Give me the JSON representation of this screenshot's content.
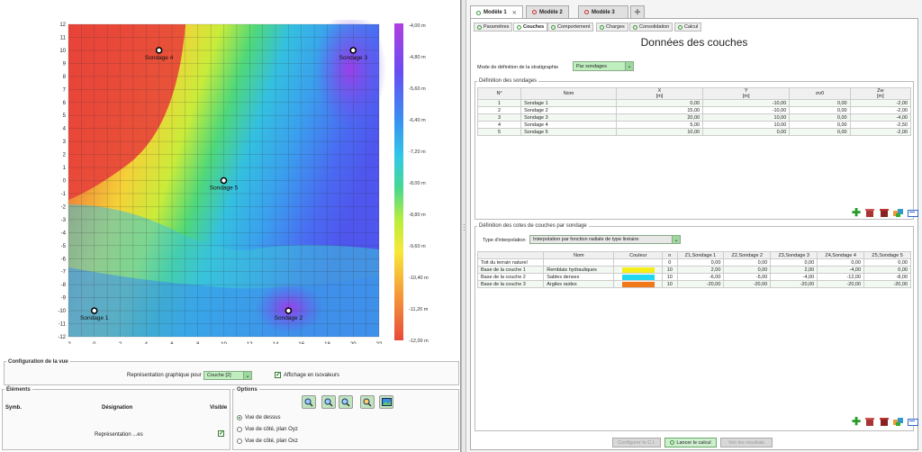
{
  "map": {
    "x_ticks": [
      "-2",
      "0",
      "2",
      "4",
      "6",
      "8",
      "10",
      "12",
      "14",
      "16",
      "18",
      "20",
      "22"
    ],
    "y_ticks": [
      "12",
      "11",
      "10",
      "9",
      "8",
      "7",
      "6",
      "5",
      "4",
      "3",
      "2",
      "1",
      "0",
      "-1",
      "-2",
      "-3",
      "-4",
      "-5",
      "-6",
      "-7",
      "-8",
      "-9",
      "-10",
      "-11",
      "-12"
    ],
    "points": [
      {
        "label": "Sondage 4",
        "x": 5,
        "y": 10
      },
      {
        "label": "Sondage 3",
        "x": 20,
        "y": 10
      },
      {
        "label": "Sondage 5",
        "x": 10,
        "y": 0
      },
      {
        "label": "Sondage 1",
        "x": 0,
        "y": -10
      },
      {
        "label": "Sondage 2",
        "x": 15,
        "y": -10
      }
    ],
    "colorbar_labels": [
      "-4,00 m",
      "-4,80 m",
      "-5,60 m",
      "-6,40 m",
      "-7,20 m",
      "-8,00 m",
      "-8,80 m",
      "-9,60 m",
      "-10,40 m",
      "-11,20 m",
      "-12,00 m"
    ]
  },
  "config": {
    "legend": "Configuration de la vue",
    "repr_label": "Représentation graphique pour",
    "repr_value": "Couche [2]",
    "isovaleurs_label": "Affichage en isovaleurs"
  },
  "elements": {
    "legend": "Éléments",
    "col_symb": "Symb.",
    "col_designation": "Désignation",
    "col_visible": "Visible",
    "row_label": "Représentation ...es"
  },
  "options": {
    "legend": "Options",
    "radio1": "Vue de dessus",
    "radio2": "Vue de côté, plan Oyz",
    "radio3": "Vue de côté, plan Oxz"
  },
  "tabs": [
    "Modèle 1",
    "Modèle 2",
    "Modèle 3"
  ],
  "subtabs": [
    "Paramètres",
    "Couches",
    "Comportement",
    "Charges",
    "Consolidation",
    "Calcul"
  ],
  "page_title": "Données des couches",
  "strat": {
    "label": "Mode de définition de la stratigraphie",
    "value": "Par sondages"
  },
  "sondages": {
    "legend": "Définition des sondages",
    "headers": [
      "N°",
      "Nom",
      "X\n[m]",
      "Y\n[m]",
      "σv0",
      "Zw\n[m]"
    ],
    "rows": [
      [
        "1",
        "Sondage 1",
        "0,00",
        "-10,00",
        "0,00",
        "-2,00"
      ],
      [
        "2",
        "Sondage 2",
        "15,00",
        "-10,00",
        "0,00",
        "-2,00"
      ],
      [
        "3",
        "Sondage 3",
        "20,00",
        "10,00",
        "0,00",
        "-4,00"
      ],
      [
        "4",
        "Sondage 4",
        "5,00",
        "10,00",
        "0,00",
        "-2,50"
      ],
      [
        "5",
        "Sondage 5",
        "10,00",
        "0,00",
        "0,00",
        "-2,00"
      ]
    ]
  },
  "cotes": {
    "legend": "Définition des cotes de couches par sondage",
    "interp_label": "Type d'interpolation",
    "interp_value": "Interpolation par fonction radiale de type linéaire",
    "headers": [
      "",
      "Nom",
      "Couleur",
      "n",
      "Z1,Sondage 1",
      "Z2,Sondage 2",
      "Z3,Sondage 3",
      "Z4,Sondage 4",
      "Z5,Sondage 5"
    ],
    "rows": [
      {
        "label": "Toit du terrain naturel",
        "nom": "",
        "color": "",
        "n": "0",
        "v": [
          "0,00",
          "0,00",
          "0,00",
          "0,00",
          "0,00"
        ]
      },
      {
        "label": "Base de la couche 1",
        "nom": "Remblais hydrauliques",
        "color": "#f5ee18",
        "n": "10",
        "v": [
          "2,00",
          "0,00",
          "2,00",
          "-4,00",
          "0,00"
        ]
      },
      {
        "label": "Base de la couche 2",
        "nom": "Sables denses",
        "color": "#22d8f0",
        "n": "10",
        "v": [
          "-6,00",
          "-5,00",
          "-4,00",
          "-12,00",
          "-8,00"
        ]
      },
      {
        "label": "Base de la couche 3",
        "nom": "Argiles raides",
        "color": "#f07818",
        "n": "10",
        "v": [
          "-20,00",
          "-20,00",
          "-20,00",
          "-20,00",
          "-20,00"
        ]
      }
    ]
  },
  "bottom": {
    "btn1": "Configurer le C.I.",
    "btn2": "Lancer le calcul",
    "btn3": "Voir les résultats"
  }
}
